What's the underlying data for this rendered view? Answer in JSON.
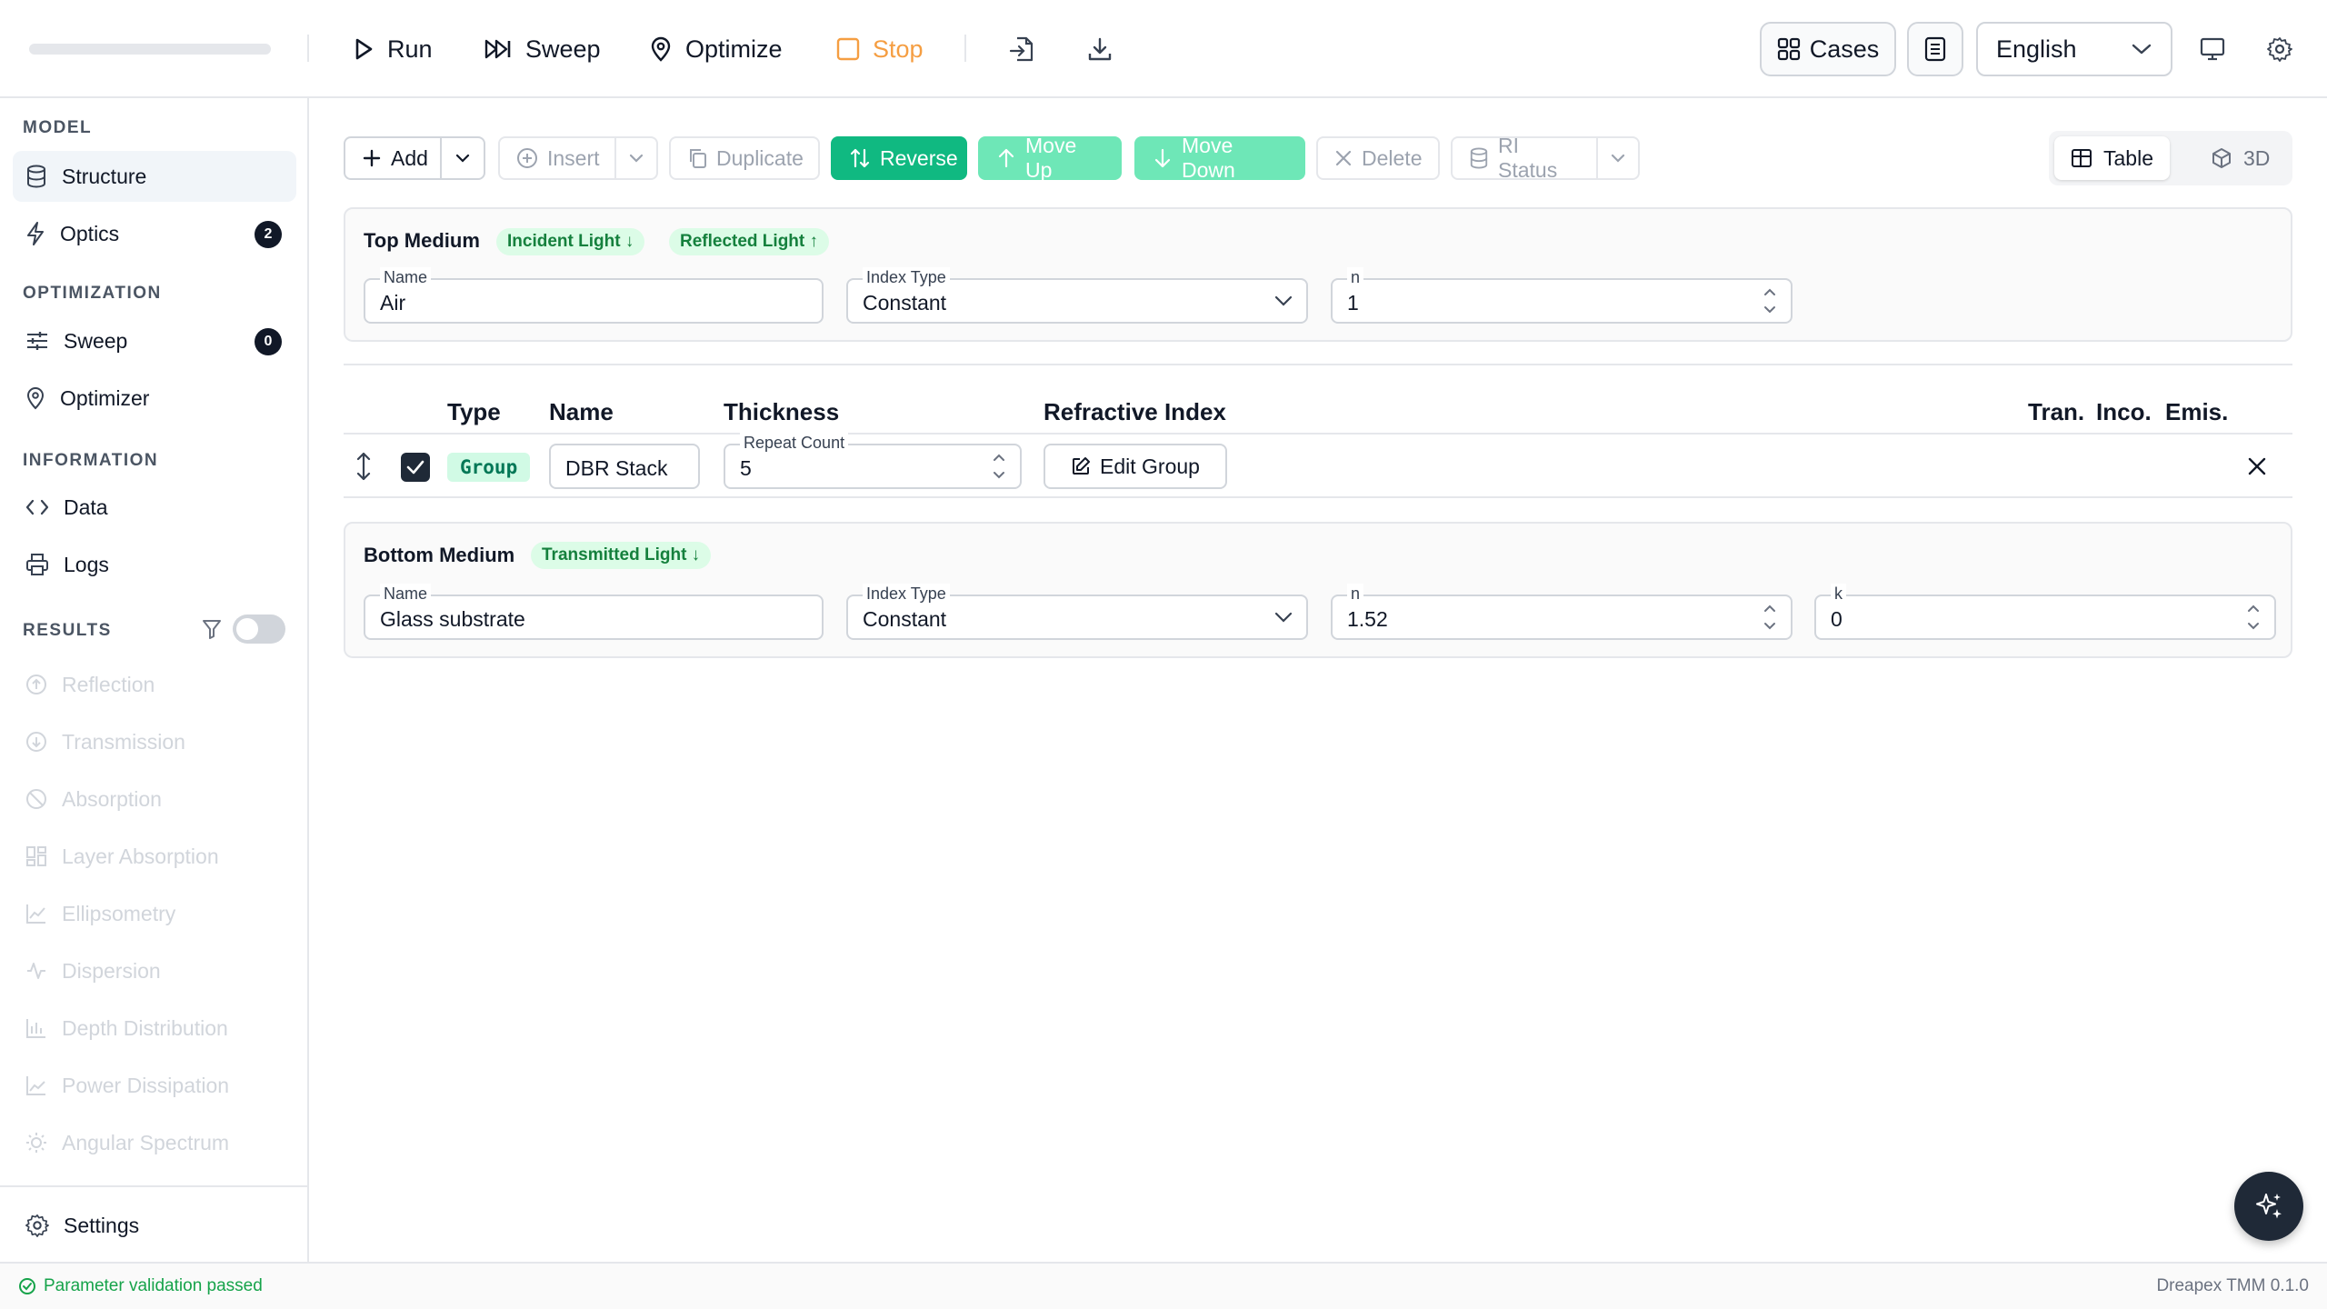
{
  "toolbar": {
    "run": "Run",
    "sweep": "Sweep",
    "optimize": "Optimize",
    "stop": "Stop",
    "cases": "Cases",
    "language": "English"
  },
  "sidebar": {
    "sections": {
      "model": "MODEL",
      "optimization": "OPTIMIZATION",
      "information": "INFORMATION",
      "results": "RESULTS"
    },
    "items": {
      "structure": "Structure",
      "optics": "Optics",
      "optics_badge": "2",
      "sweep": "Sweep",
      "sweep_badge": "0",
      "optimizer": "Optimizer",
      "data": "Data",
      "logs": "Logs"
    },
    "results": [
      "Reflection",
      "Transmission",
      "Absorption",
      "Layer Absorption",
      "Ellipsometry",
      "Dispersion",
      "Depth Distribution",
      "Power Dissipation",
      "Angular Spectrum"
    ],
    "results_toggle": false,
    "settings": "Settings"
  },
  "actions": {
    "add": "Add",
    "insert": "Insert",
    "duplicate": "Duplicate",
    "reverse": "Reverse",
    "move_up": "Move Up",
    "move_down": "Move Down",
    "delete": "Delete",
    "ri_status": "RI Status"
  },
  "view": {
    "table": "Table",
    "three_d": "3D",
    "selected": "Table"
  },
  "top_medium": {
    "title": "Top Medium",
    "tag_incident": "Incident Light ↓",
    "tag_reflected": "Reflected Light ↑",
    "name_label": "Name",
    "name_value": "Air",
    "index_type_label": "Index Type",
    "index_type_value": "Constant",
    "n_label": "n",
    "n_value": "1"
  },
  "table": {
    "headers": {
      "type": "Type",
      "name": "Name",
      "thickness": "Thickness",
      "ri": "Refractive Index",
      "tran": "Tran.",
      "inco": "Inco.",
      "emis": "Emis."
    },
    "row": {
      "type": "Group",
      "name": "DBR Stack",
      "repeat_label": "Repeat Count",
      "repeat_value": "5",
      "edit_group": "Edit Group",
      "checked": true
    }
  },
  "bottom_medium": {
    "title": "Bottom Medium",
    "tag_transmitted": "Transmitted Light ↓",
    "name_label": "Name",
    "name_value": "Glass substrate",
    "index_type_label": "Index Type",
    "index_type_value": "Constant",
    "n_label": "n",
    "n_value": "1.52",
    "k_label": "k",
    "k_value": "0"
  },
  "status": {
    "message": "Parameter validation passed",
    "version": "Dreapex TMM 0.1.0"
  },
  "colors": {
    "accent_green": "#10b981",
    "stop_orange": "#f59e42",
    "status_green": "#16a34a"
  }
}
